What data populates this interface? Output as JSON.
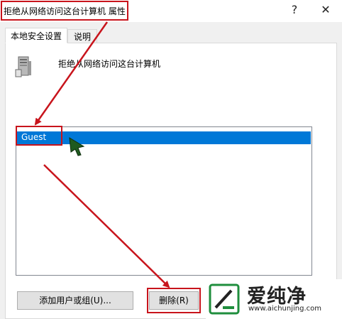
{
  "window": {
    "title": "拒绝从网络访问这台计算机 属性",
    "help_label": "?",
    "close_label": "✕"
  },
  "tabs": [
    {
      "label": "本地安全设置",
      "active": true
    },
    {
      "label": "说明",
      "active": false
    }
  ],
  "policy": {
    "icon": "server-computer-icon",
    "name": "拒绝从网络访问这台计算机"
  },
  "accounts_list": {
    "items": [
      {
        "label": "Guest",
        "selected": true
      }
    ]
  },
  "buttons": {
    "add_label": "添加用户或组(U)...",
    "remove_label": "删除(R)"
  },
  "watermark": {
    "text": "爱纯净",
    "url": "www.aichunjing.com",
    "icon": "brand-logo-icon"
  },
  "colors": {
    "selection": "#0078d7",
    "annotation": "#c8141c",
    "dialog_bg": "#f0f0f0"
  }
}
